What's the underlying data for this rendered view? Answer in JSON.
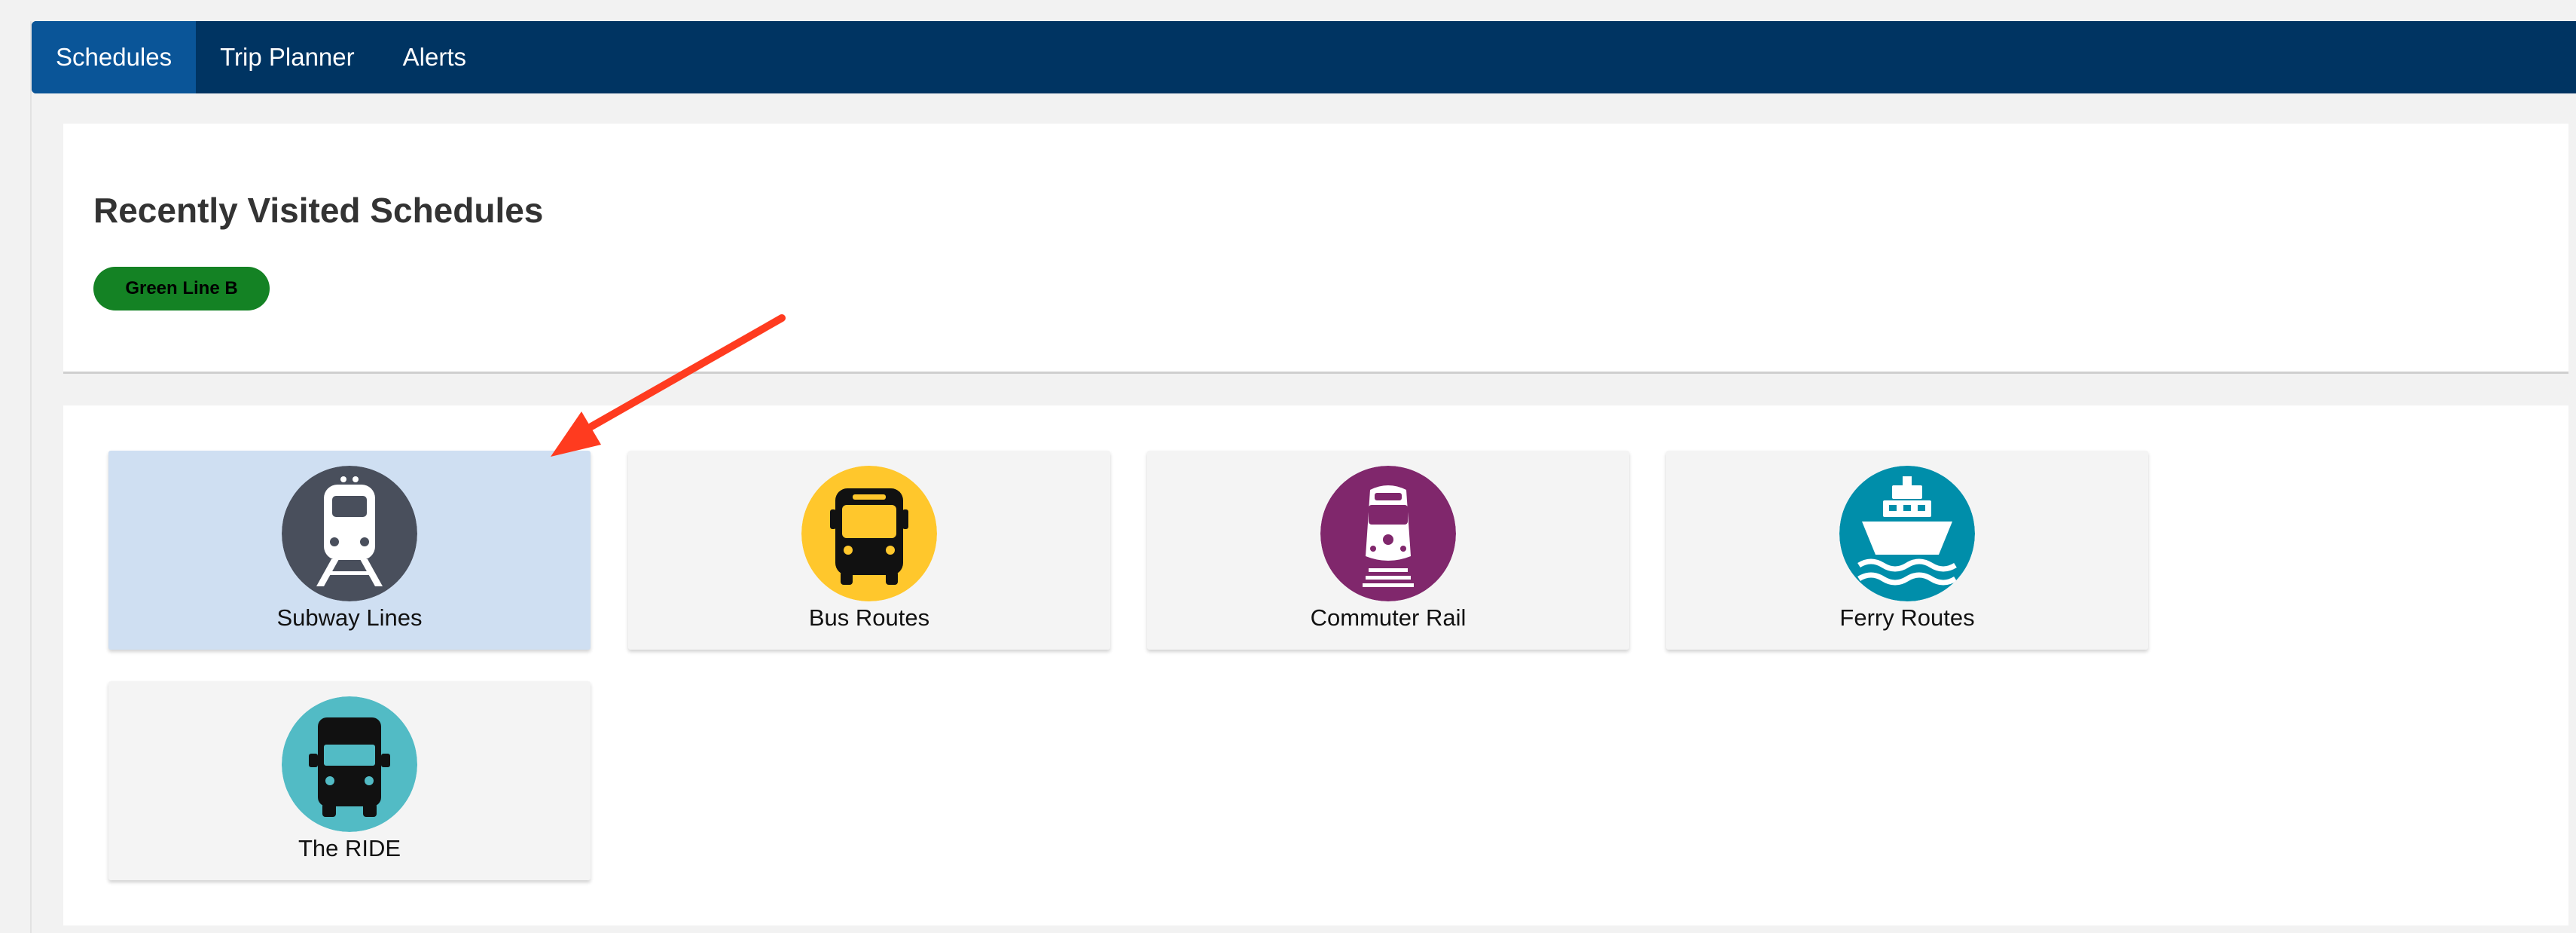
{
  "nav": {
    "tabs": [
      {
        "label": "Schedules",
        "active": true
      },
      {
        "label": "Trip Planner",
        "active": false
      },
      {
        "label": "Alerts",
        "active": false
      }
    ]
  },
  "recent": {
    "title": "Recently Visited Schedules",
    "items": [
      {
        "label": "Green Line B",
        "color": "#148224"
      }
    ]
  },
  "modes": {
    "items": [
      {
        "label": "Subway Lines",
        "icon": "subway-icon",
        "color": "#494f5c",
        "selected": true
      },
      {
        "label": "Bus Routes",
        "icon": "bus-icon",
        "color": "#ffc72c",
        "selected": false
      },
      {
        "label": "Commuter Rail",
        "icon": "commuter-rail-icon",
        "color": "#80276c",
        "selected": false
      },
      {
        "label": "Ferry Routes",
        "icon": "ferry-icon",
        "color": "#008eaa",
        "selected": false
      },
      {
        "label": "The RIDE",
        "icon": "ride-van-icon",
        "color": "#52bbc5",
        "selected": false
      }
    ]
  },
  "colors": {
    "nav_background": "#003462",
    "nav_active": "#0a5598",
    "selected_card": "#cfdff2",
    "annotation_arrow": "#ff3b1f"
  }
}
